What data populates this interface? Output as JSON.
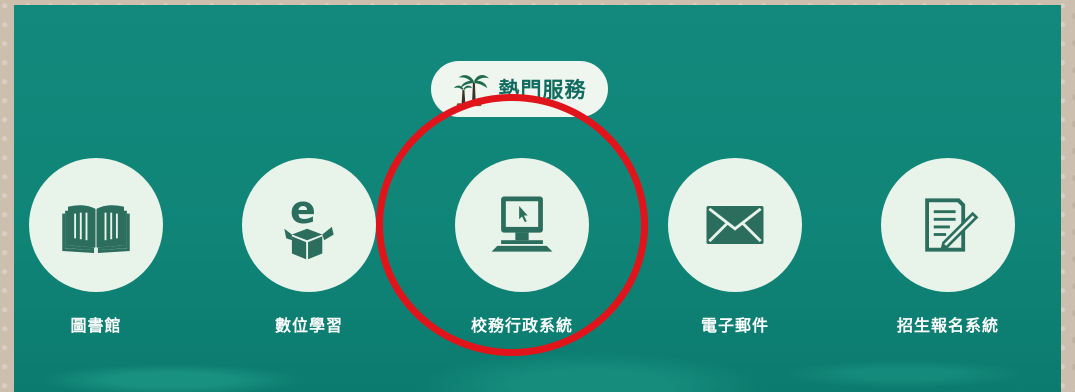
{
  "header": {
    "title": "熱門服務",
    "title_icon": "palm-trees-icon"
  },
  "services": [
    {
      "label": "圖書館",
      "icon": "open-book-icon"
    },
    {
      "label": "數位學習",
      "icon": "e-learning-box-icon"
    },
    {
      "label": "校務行政系統",
      "icon": "computer-terminal-icon"
    },
    {
      "label": "電子郵件",
      "icon": "envelope-icon"
    },
    {
      "label": "招生報名系統",
      "icon": "form-pencil-icon"
    }
  ],
  "colors": {
    "panel_bg": "#108679",
    "circle_bg": "#e8f3ea",
    "icon_color": "#2b6e5e",
    "highlight": "#e1141b"
  }
}
